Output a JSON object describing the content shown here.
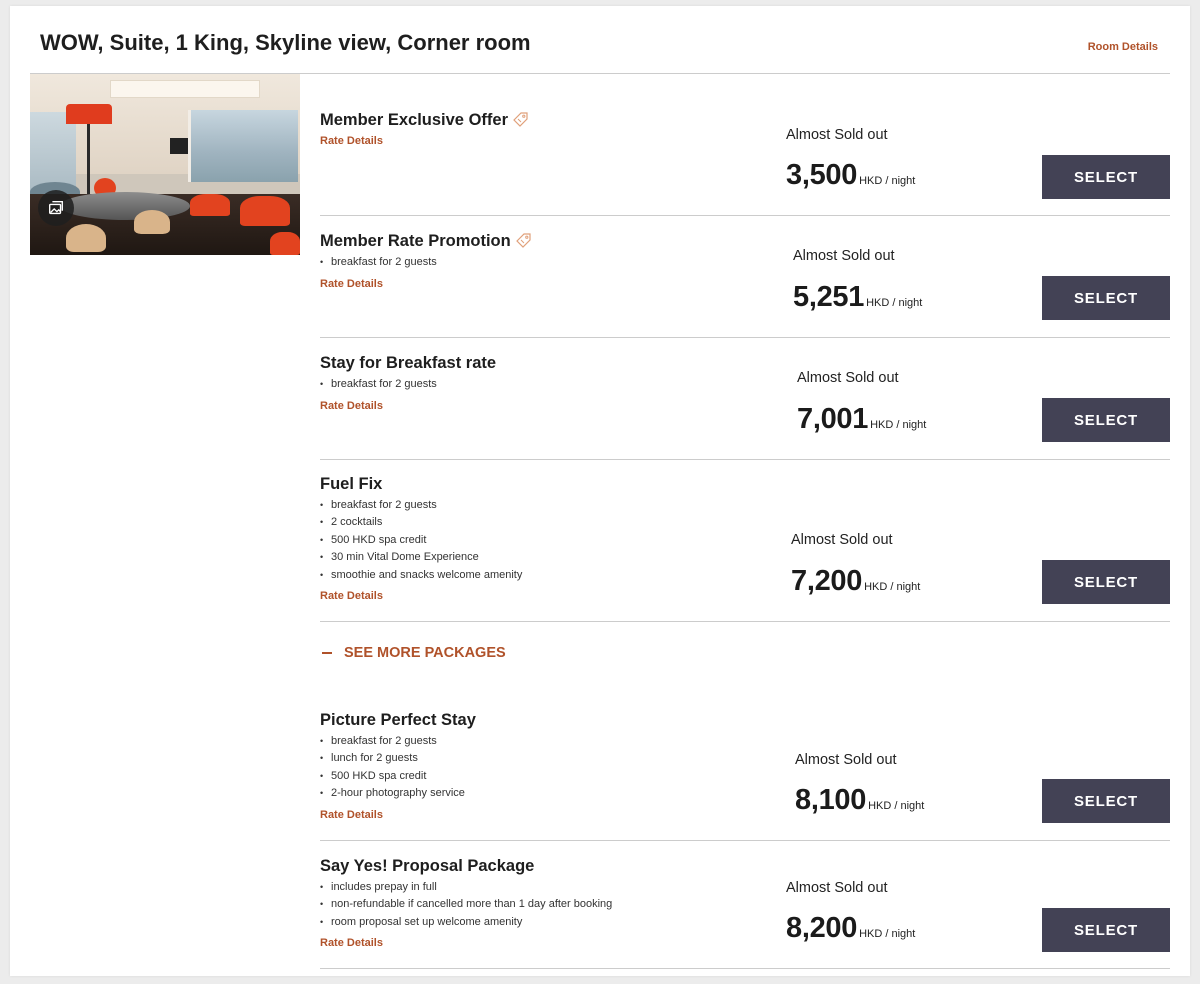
{
  "room": {
    "title": "WOW, Suite, 1 King, Skyline view, Corner room",
    "room_details_label": "Room Details"
  },
  "rates": [
    {
      "name": "Member Exclusive Offer",
      "has_tag_icon": true,
      "inclusions": [],
      "rate_details_label": "Rate Details",
      "availability": "Almost Sold out",
      "price": "3,500",
      "unit": "HKD / night",
      "select_label": "SELECT"
    },
    {
      "name": "Member Rate Promotion",
      "has_tag_icon": true,
      "inclusions": [
        "breakfast for 2 guests"
      ],
      "rate_details_label": "Rate Details",
      "availability": "Almost Sold out",
      "price": "5,251",
      "unit": "HKD / night",
      "select_label": "SELECT"
    },
    {
      "name": "Stay for Breakfast rate",
      "has_tag_icon": false,
      "inclusions": [
        "breakfast for 2 guests"
      ],
      "rate_details_label": "Rate Details",
      "availability": "Almost Sold out",
      "price": "7,001",
      "unit": "HKD / night",
      "select_label": "SELECT"
    },
    {
      "name": "Fuel Fix",
      "has_tag_icon": false,
      "inclusions": [
        "breakfast for 2 guests",
        "2 cocktails",
        "500 HKD spa credit",
        "30 min Vital Dome Experience",
        "smoothie and snacks welcome amenity"
      ],
      "rate_details_label": "Rate Details",
      "availability": "Almost Sold out",
      "price": "7,200",
      "unit": "HKD / night",
      "select_label": "SELECT"
    },
    {
      "name": "Picture Perfect Stay",
      "has_tag_icon": false,
      "inclusions": [
        "breakfast for 2 guests",
        "lunch for 2 guests",
        "500 HKD spa credit",
        "2-hour photography service"
      ],
      "rate_details_label": "Rate Details",
      "availability": "Almost Sold out",
      "price": "8,100",
      "unit": "HKD / night",
      "select_label": "SELECT"
    },
    {
      "name": "Say Yes! Proposal Package",
      "has_tag_icon": false,
      "inclusions": [
        "includes prepay in full",
        "non-refundable if cancelled more than 1 day after booking",
        "room proposal set up welcome amenity"
      ],
      "rate_details_label": "Rate Details",
      "availability": "Almost Sold out",
      "price": "8,200",
      "unit": "HKD / night",
      "select_label": "SELECT"
    }
  ],
  "see_more_packages_label": "SEE MORE PACKAGES",
  "colors": {
    "accent": "#b0522a",
    "button": "#434255"
  },
  "icons": {
    "tag": "tag-icon",
    "gallery": "gallery-icon",
    "collapse": "minus-icon"
  }
}
